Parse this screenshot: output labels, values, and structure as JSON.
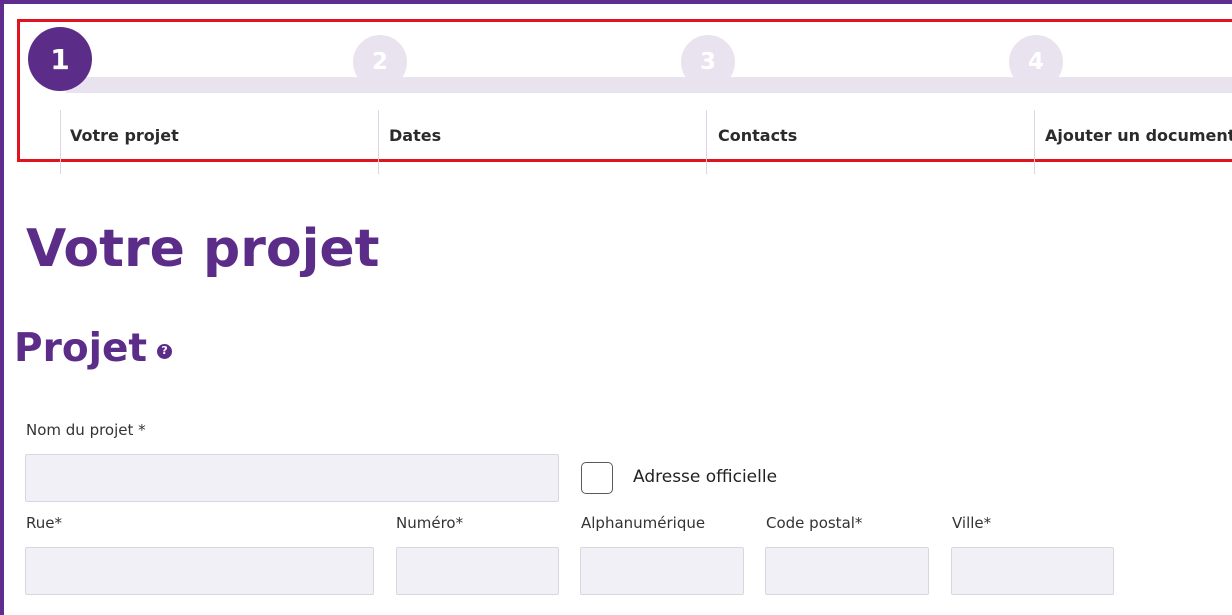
{
  "stepper": {
    "steps": [
      {
        "number": "1",
        "label": "Votre projet",
        "active": true
      },
      {
        "number": "2",
        "label": "Dates",
        "active": false
      },
      {
        "number": "3",
        "label": "Contacts",
        "active": false
      },
      {
        "number": "4",
        "label": "Ajouter un document",
        "active": false
      }
    ]
  },
  "page": {
    "title": "Votre projet"
  },
  "section": {
    "title": "Projet",
    "help_icon": "?"
  },
  "form": {
    "project_name_label": "Nom du projet *",
    "project_name_value": "",
    "official_address_label": "Adresse officielle",
    "official_address_checked": false,
    "street_label": "Rue*",
    "street_value": "",
    "number_label": "Numéro*",
    "number_value": "",
    "alphanumeric_label": "Alphanumérique",
    "alphanumeric_value": "",
    "postal_code_label": "Code postal*",
    "postal_code_value": "",
    "city_label": "Ville*",
    "city_value": ""
  },
  "colors": {
    "brand_purple": "#5b2d89",
    "step_inactive": "#e9e2ef",
    "highlight_border": "#e0141e"
  }
}
